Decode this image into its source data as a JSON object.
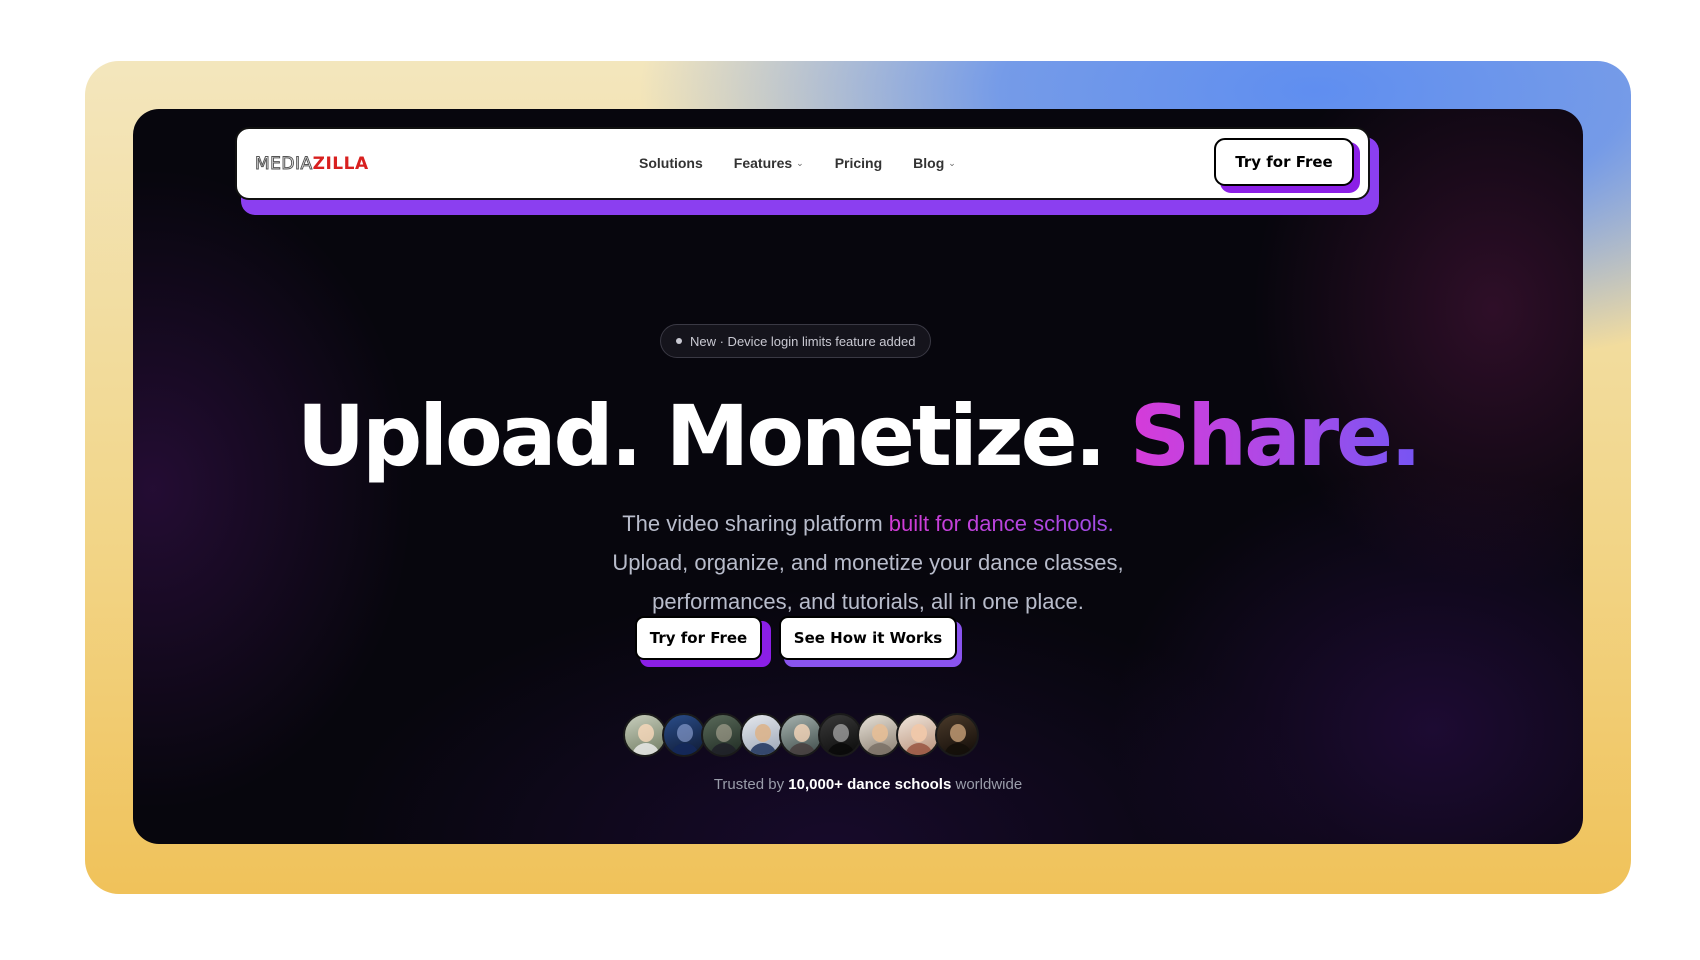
{
  "logo": {
    "part1": "MEDIA",
    "part2": "ZILLA"
  },
  "nav": {
    "items": [
      {
        "label": "Solutions",
        "dropdown": false
      },
      {
        "label": "Features",
        "dropdown": true
      },
      {
        "label": "Pricing",
        "dropdown": false
      },
      {
        "label": "Blog",
        "dropdown": true
      }
    ],
    "cta_label": "Try for Free"
  },
  "badge": {
    "text": "New · Device login limits feature added"
  },
  "hero": {
    "headline_white": "Upload. Monetize. ",
    "headline_gradient": "Share.",
    "sub_line1_plain": "The video sharing platform ",
    "sub_line1_highlight": "built for dance schools.",
    "sub_line2": "Upload, organize, and monetize your dance classes,",
    "sub_line3": "performances, and tutorials, all in one place.",
    "primary_cta": "Try for Free",
    "secondary_cta": "See How it Works"
  },
  "social_proof": {
    "avatar_count": 9,
    "prefix": "Trusted by ",
    "bold": "10,000+ dance schools",
    "suffix": " worldwide"
  },
  "colors": {
    "background": "#07060d",
    "accent_purple": "#8b1fe6",
    "gradient_pink": "#d63bd9",
    "gradient_violet": "#7655f3",
    "logo_red": "#d8201f"
  }
}
